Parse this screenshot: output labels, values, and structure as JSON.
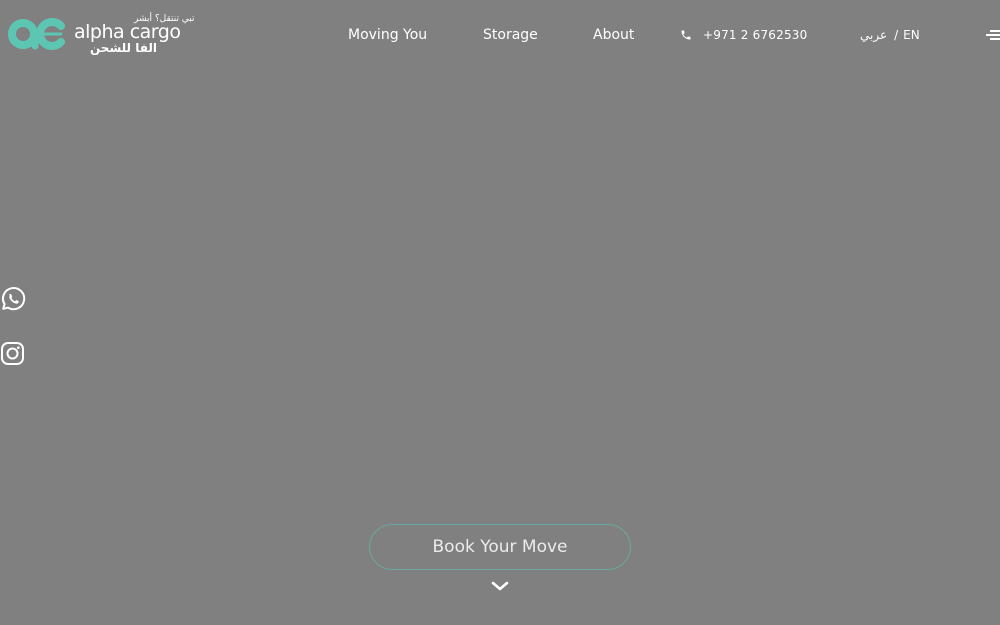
{
  "brand": {
    "mark": "ac",
    "tagline_ar": "تبي تنتقل؟ أبشر",
    "name_en": "alpha cargo",
    "name_ar": "الفا للشحن",
    "accent_color": "#5cc6b3"
  },
  "nav": {
    "items": [
      {
        "label": "Moving You"
      },
      {
        "label": "Storage"
      },
      {
        "label": "About"
      }
    ]
  },
  "contact": {
    "phone": "+971 2 6762530",
    "icon": "phone-icon"
  },
  "language": {
    "arabic_label": "عربي",
    "separator": "/",
    "english_label": "EN"
  },
  "menu": {
    "icon": "hamburger-menu-icon"
  },
  "social": {
    "items": [
      {
        "icon": "whatsapp-icon"
      },
      {
        "icon": "instagram-icon"
      }
    ]
  },
  "hero": {
    "cta_label": "Book Your Move",
    "cta_border_color": "#6aa79c",
    "scroll_icon": "chevron-down-icon"
  },
  "colors": {
    "background": "#808080",
    "text": "#ffffff"
  }
}
